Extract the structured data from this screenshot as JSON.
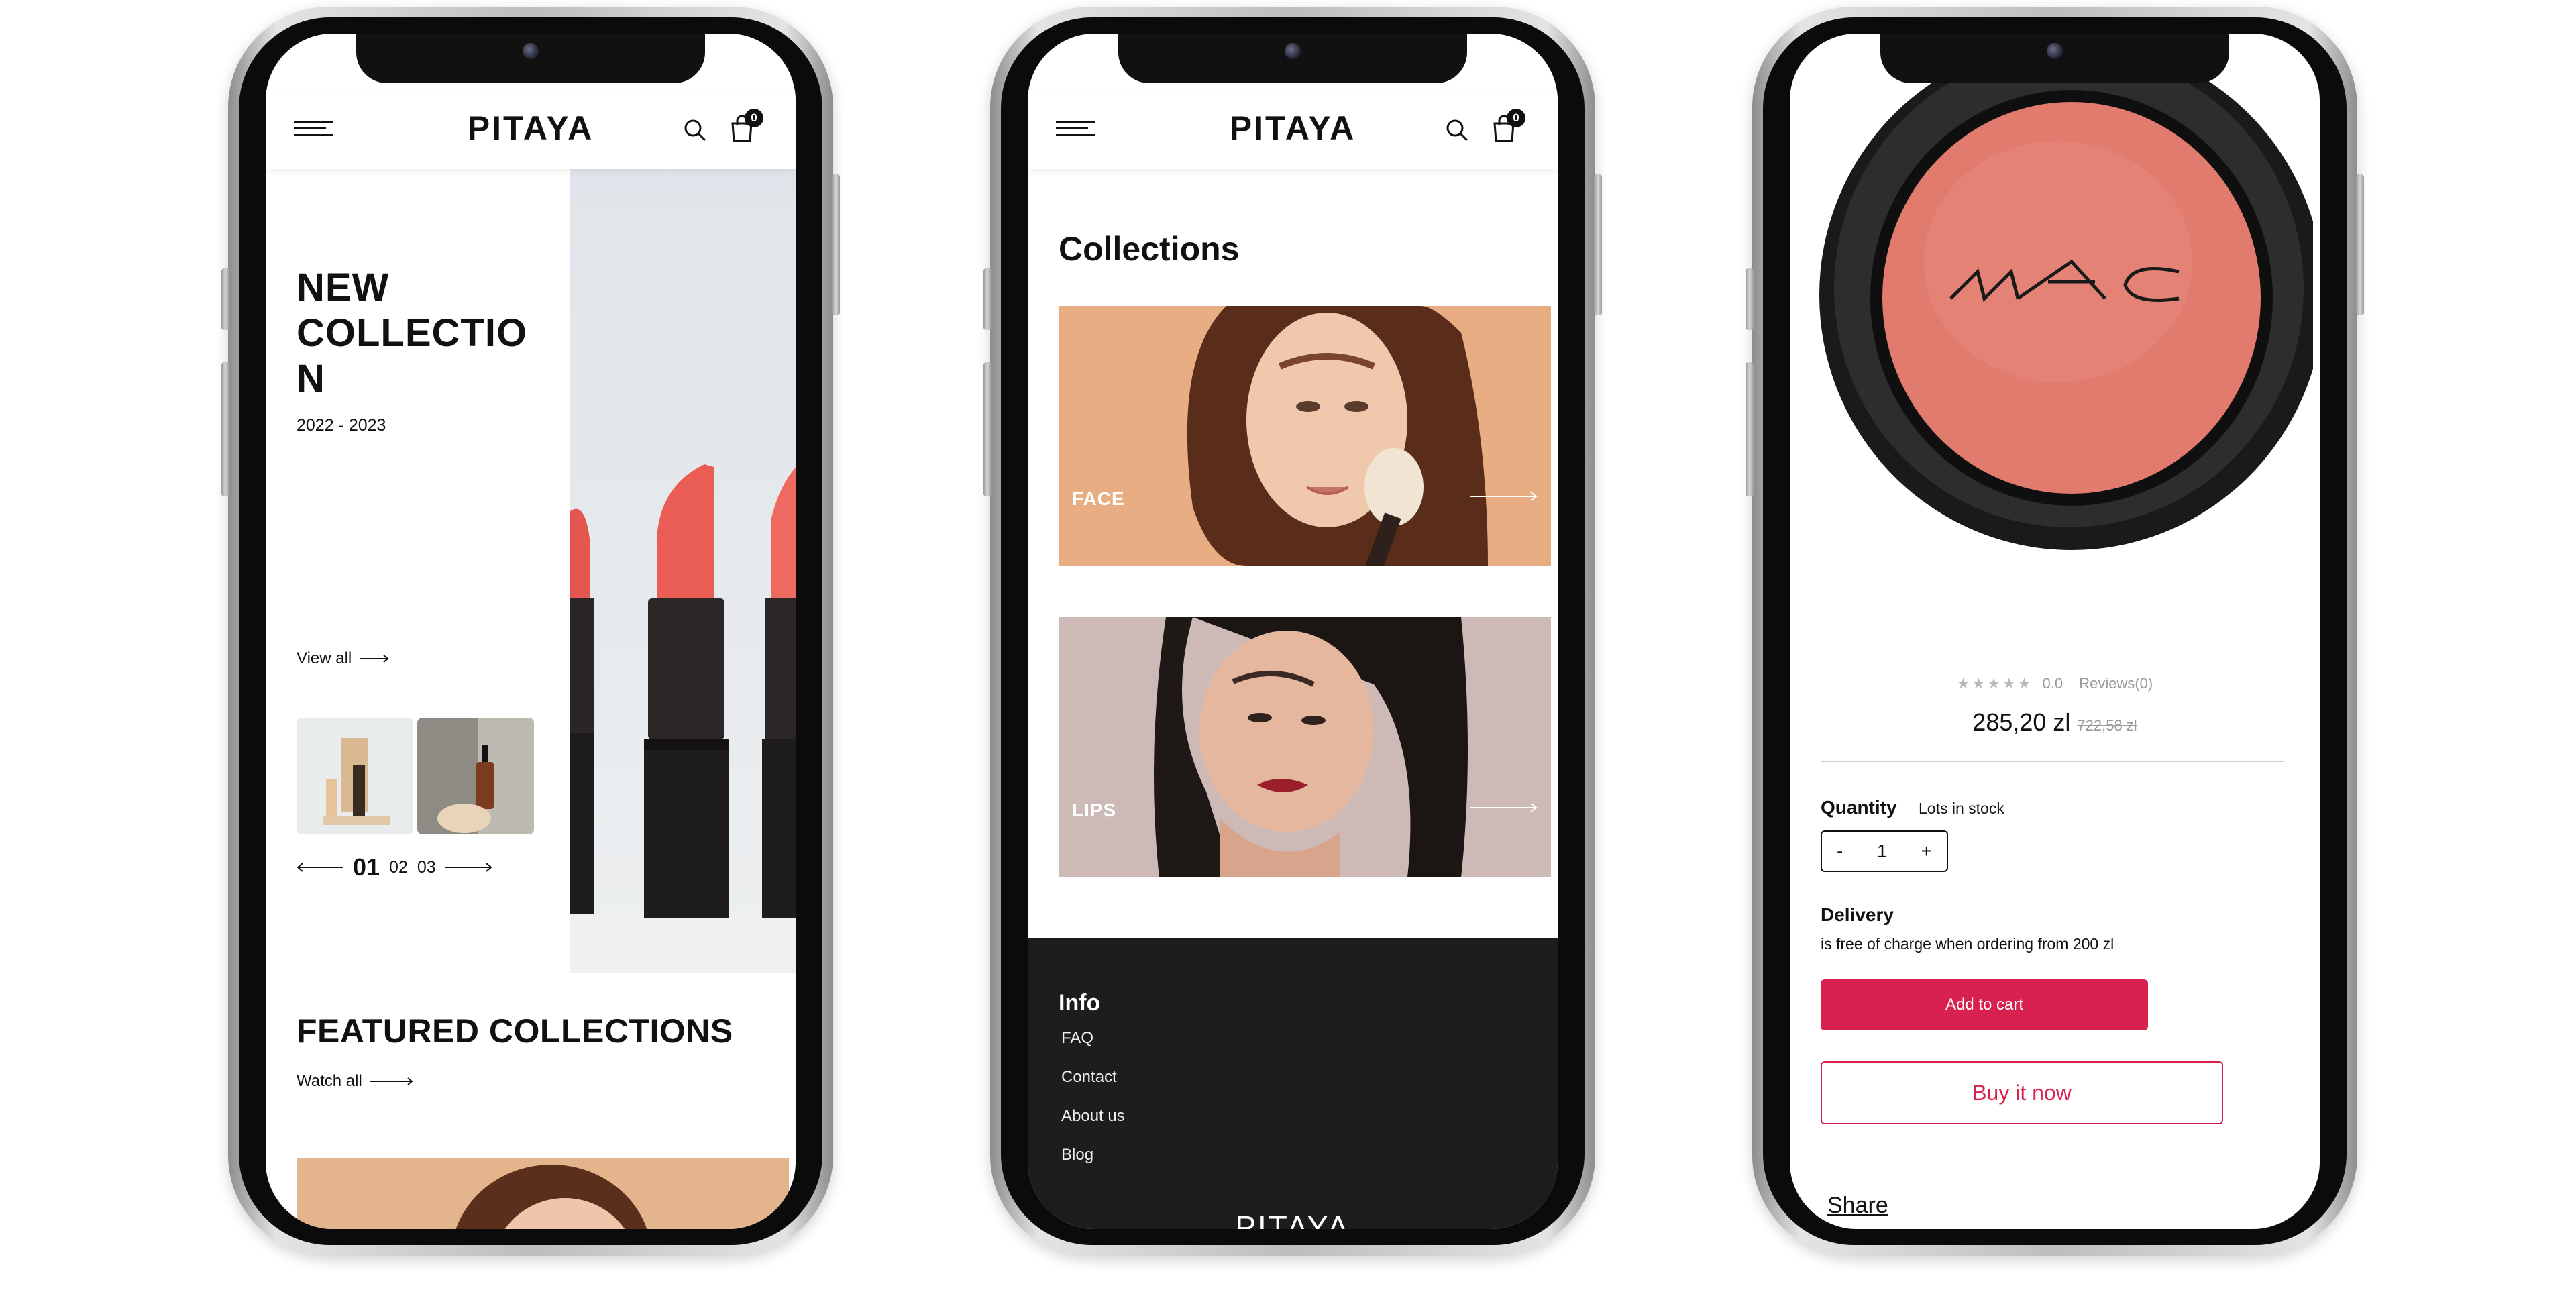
{
  "brand": {
    "logo": "PITAYA",
    "cart_count": "0"
  },
  "home": {
    "hero_title": "NEW COLLECTIO N",
    "hero_years": "2022 - 2023",
    "view_all": "View all",
    "pager": {
      "current": "01",
      "second": "02",
      "third": "03"
    },
    "featured_title": "FEATURED COLLECTIONS",
    "watch_all": "Watch all"
  },
  "collections": {
    "title": "Collections",
    "cards": [
      {
        "label": "FACE"
      },
      {
        "label": "LIPS"
      }
    ],
    "footer": {
      "info_title": "Info",
      "links": [
        "FAQ",
        "Contact",
        "About us",
        "Blog"
      ],
      "logo": "PITAYA"
    }
  },
  "product": {
    "brand_mark": "MAC",
    "rating": "0.0",
    "reviews": "Reviews(0)",
    "price": "285,20 zl",
    "old_price": "722,58 zl",
    "quantity_label": "Quantity",
    "stock_text": "Lots in stock",
    "quantity_value": "1",
    "minus": "-",
    "plus": "+",
    "delivery_label": "Delivery",
    "delivery_text": "is free of charge when ordering from 200 zl",
    "add_to_cart": "Add to cart",
    "buy_now": "Buy it now",
    "share": "Share"
  },
  "colors": {
    "accent": "#d9214f",
    "footer_bg": "#1d1d1d",
    "blush": "#e07b6e"
  }
}
